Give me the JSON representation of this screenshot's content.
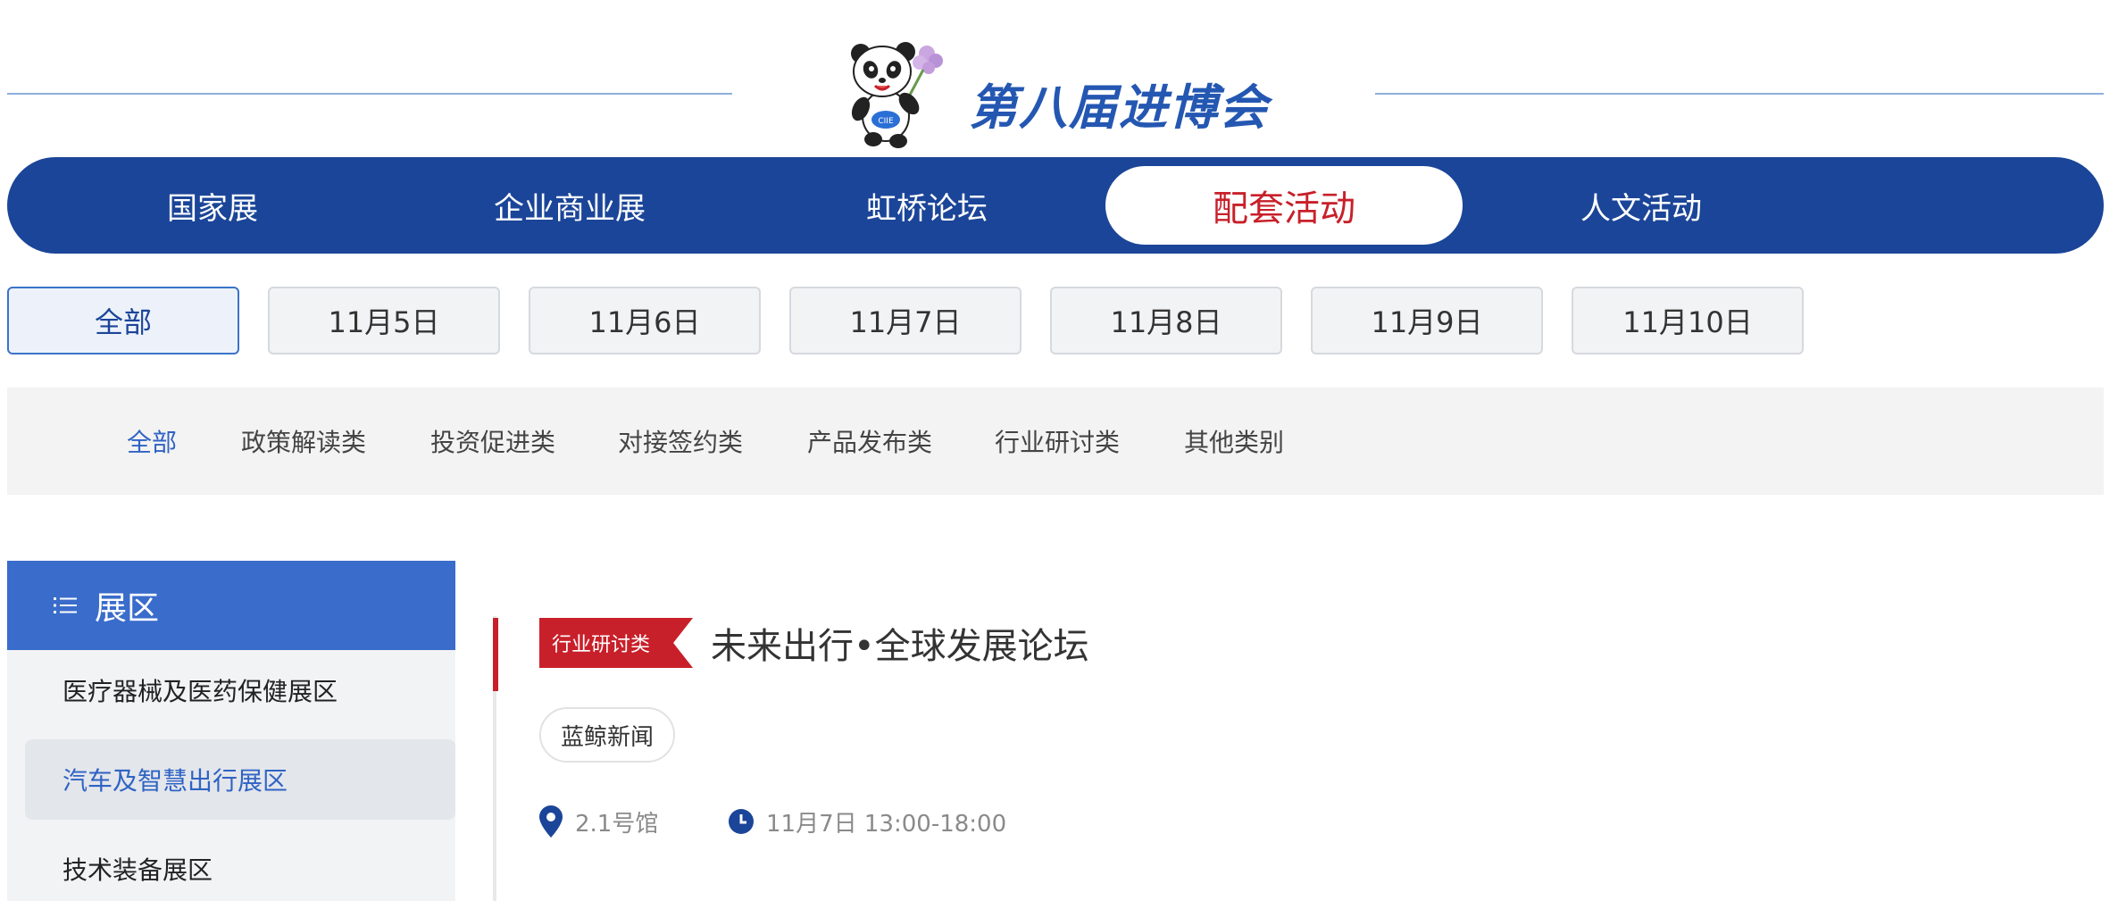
{
  "header": {
    "logo_text": "第八届进博会",
    "mascot_icon": "panda-mascot-icon",
    "line_color": "#8fb0dd",
    "brand_color": "#2457b2"
  },
  "main_nav": {
    "color": "#1b4598",
    "active_color": "#c8202a",
    "items": [
      {
        "label": "国家展",
        "active": false
      },
      {
        "label": "企业商业展",
        "active": false
      },
      {
        "label": "虹桥论坛",
        "active": false
      },
      {
        "label": "配套活动",
        "active": true
      },
      {
        "label": "人文活动",
        "active": false
      }
    ]
  },
  "date_filter": {
    "items": [
      {
        "label": "全部",
        "active": true
      },
      {
        "label": "11月5日",
        "active": false
      },
      {
        "label": "11月6日",
        "active": false
      },
      {
        "label": "11月7日",
        "active": false
      },
      {
        "label": "11月8日",
        "active": false
      },
      {
        "label": "11月9日",
        "active": false
      },
      {
        "label": "11月10日",
        "active": false
      }
    ]
  },
  "category_filter": {
    "items": [
      {
        "label": "全部",
        "active": true
      },
      {
        "label": "政策解读类",
        "active": false
      },
      {
        "label": "投资促进类",
        "active": false
      },
      {
        "label": "对接签约类",
        "active": false
      },
      {
        "label": "产品发布类",
        "active": false
      },
      {
        "label": "行业研讨类",
        "active": false
      },
      {
        "label": "其他类别",
        "active": false
      }
    ]
  },
  "sidebar": {
    "heading": "展区",
    "heading_icon": "list-icon",
    "items": [
      {
        "label": "医疗器械及医药保健展区",
        "active": false
      },
      {
        "label": "汽车及智慧出行展区",
        "active": true
      },
      {
        "label": "技术装备展区",
        "active": false
      }
    ]
  },
  "event": {
    "tag": "行业研讨类",
    "title": "未来出行•全球发展论坛",
    "source": "蓝鲸新闻",
    "location": "2.1号馆",
    "location_icon": "location-pin-icon",
    "time": "11月7日 13:00-18:00",
    "time_icon": "clock-icon",
    "accent_color": "#c8202a"
  }
}
